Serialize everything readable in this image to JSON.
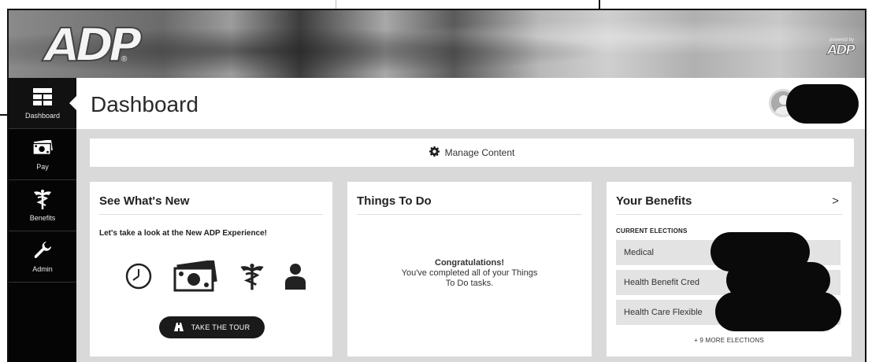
{
  "brand": {
    "logo_text": "ADP",
    "logo_mark": "®",
    "powered_by_label": "powered by",
    "powered_by_logo": "ADP"
  },
  "sidebar": {
    "items": [
      {
        "label": "Dashboard",
        "icon": "dashboard-icon",
        "active": true
      },
      {
        "label": "Pay",
        "icon": "money-icon",
        "active": false
      },
      {
        "label": "Benefits",
        "icon": "caduceus-icon",
        "active": false
      },
      {
        "label": "Admin",
        "icon": "wrench-icon",
        "active": false
      }
    ]
  },
  "header": {
    "title": "Dashboard"
  },
  "manage_content": {
    "label": "Manage Content",
    "icon": "gear-icon"
  },
  "cards": {
    "whats_new": {
      "title": "See What's New",
      "subtitle": "Let's take a look at the New ADP Experience!",
      "icons": [
        "clock-icon",
        "money-icon",
        "caduceus-icon",
        "person-icon"
      ],
      "tour_button": "TAKE THE TOUR"
    },
    "things_to_do": {
      "title": "Things To Do",
      "message_title": "Congratulations!",
      "message_line1": "You've completed all of your Things",
      "message_line2": "To Do tasks."
    },
    "benefits": {
      "title": "Your Benefits",
      "chevron": ">",
      "section_label": "CURRENT ELECTIONS",
      "elections": [
        "Medical",
        "Health Benefit Cred",
        "Health Care Flexible"
      ],
      "more_link": "+ 9 MORE ELECTIONS"
    }
  },
  "colors": {
    "sidebar_bg": "#050505",
    "page_bg": "#d9d9d9",
    "card_bg": "#ffffff",
    "button_bg": "#1a1a1a"
  }
}
